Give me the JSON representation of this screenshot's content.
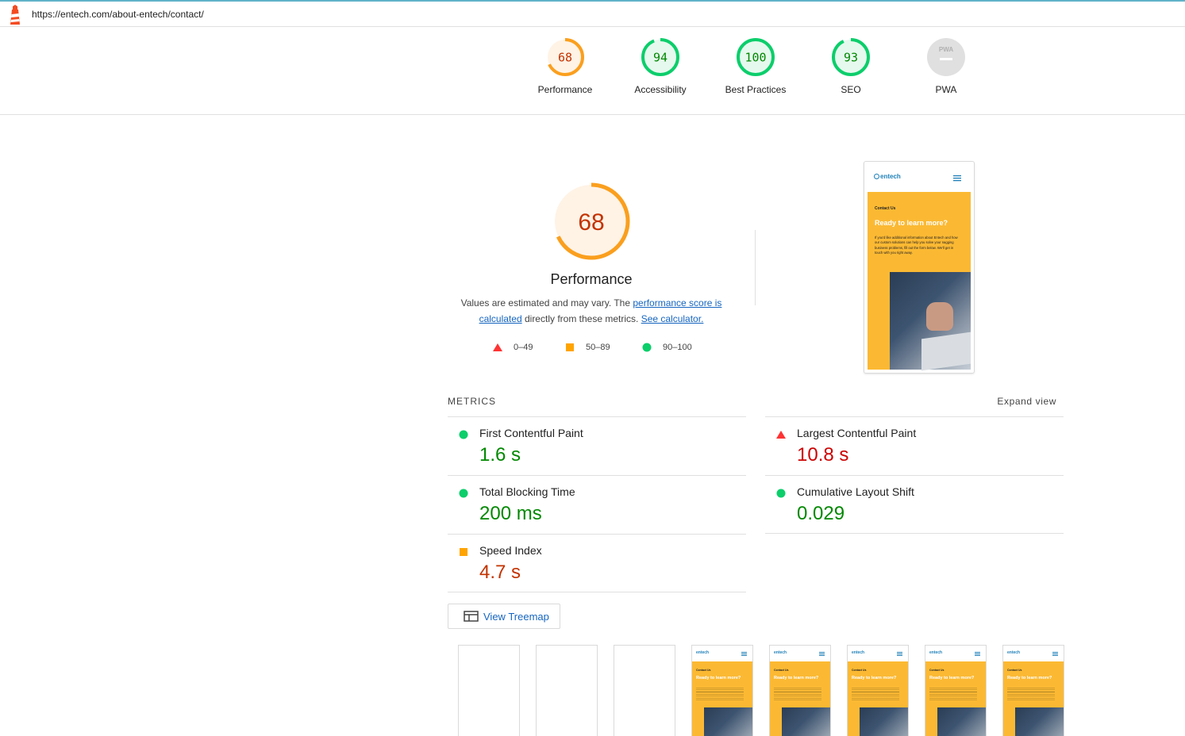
{
  "url": "https://entech.com/about-entech/contact/",
  "summary_gauges": [
    {
      "label": "Performance",
      "score": "68",
      "value": 68,
      "color": "#fa9f1e",
      "text_color": "#c33300",
      "bg": "#fff3e6"
    },
    {
      "label": "Accessibility",
      "score": "94",
      "value": 94,
      "color": "#0cce6b",
      "text_color": "#008800",
      "bg": "#e6f9ee"
    },
    {
      "label": "Best Practices",
      "score": "100",
      "value": 100,
      "color": "#0cce6b",
      "text_color": "#008800",
      "bg": "#e6f9ee"
    },
    {
      "label": "SEO",
      "score": "93",
      "value": 93,
      "color": "#0cce6b",
      "text_color": "#008800",
      "bg": "#e6f9ee"
    },
    {
      "label": "PWA",
      "score": "PWA",
      "value": 0,
      "color": "#e0e0e0",
      "text_color": "#9e9e9e",
      "bg": "#e0e0e0"
    }
  ],
  "performance": {
    "score": "68",
    "value": 68,
    "title": "Performance",
    "desc_prefix": "Values are estimated and may vary. The ",
    "desc_link1": "performance score is calculated",
    "desc_mid": " directly from these metrics. ",
    "desc_link2": "See calculator."
  },
  "legend": [
    {
      "shape": "triangle",
      "label": "0–49",
      "color": "#ff3333"
    },
    {
      "shape": "square",
      "label": "50–89",
      "color": "#ffa400"
    },
    {
      "shape": "circle",
      "label": "90–100",
      "color": "#0cce6b"
    }
  ],
  "screenshot": {
    "brand": "entech",
    "eyebrow": "Contact Us",
    "headline": "Ready to learn more?",
    "body": "If you'd like additional information about Entech and how our custom solutions can help you solve your nagging business problems, fill out the form below. We'll get in touch with you right away."
  },
  "metrics_header": "METRICS",
  "expand_view": "Expand view",
  "metrics": [
    {
      "name": "First Contentful Paint",
      "value": "1.6 s",
      "status": "pass"
    },
    {
      "name": "Largest Contentful Paint",
      "value": "10.8 s",
      "status": "fail"
    },
    {
      "name": "Total Blocking Time",
      "value": "200 ms",
      "status": "pass"
    },
    {
      "name": "Cumulative Layout Shift",
      "value": "0.029",
      "status": "pass"
    },
    {
      "name": "Speed Index",
      "value": "4.7 s",
      "status": "avg"
    }
  ],
  "treemap_label": "View Treemap",
  "filmstrip": [
    {
      "filled": false
    },
    {
      "filled": false
    },
    {
      "filled": false
    },
    {
      "filled": true,
      "brand": "entech",
      "eyebrow": "Contact Us",
      "headline": "Ready to learn more?"
    },
    {
      "filled": true,
      "brand": "entech",
      "eyebrow": "Contact Us",
      "headline": "Ready to learn more?"
    },
    {
      "filled": true,
      "brand": "entech",
      "eyebrow": "Contact Us",
      "headline": "Ready to learn more?"
    },
    {
      "filled": true,
      "brand": "entech",
      "eyebrow": "Contact Us",
      "headline": "Ready to learn more?"
    },
    {
      "filled": true,
      "brand": "entech",
      "eyebrow": "Contact Us",
      "headline": "Ready to learn more?"
    }
  ]
}
